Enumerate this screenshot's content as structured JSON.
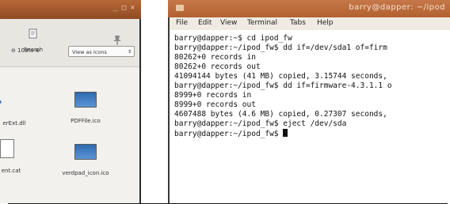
{
  "file_manager": {
    "window_buttons": "_ □ ✕",
    "search_label": "Search",
    "zoom_text": "⊖ 100% ⊕",
    "view_select": "View as Icons",
    "files": [
      {
        "name": "erExt.dll"
      },
      {
        "name": "PDFFile.ico"
      },
      {
        "name": "ent.cat"
      },
      {
        "name": "verdpad_icon.ico"
      }
    ]
  },
  "terminal": {
    "title": "barry@dapper: ~/ipod",
    "menu": [
      "File",
      "Edit",
      "View",
      "Terminal",
      "Tabs",
      "Help"
    ],
    "lines": [
      "barry@dapper:~$ cd ipod_fw",
      "barry@dapper:~/ipod_fw$ dd if=/dev/sda1 of=firm",
      "80262+0 records in",
      "80262+0 records out",
      "41094144 bytes (41 MB) copied, 3.15744 seconds,",
      "barry@dapper:~/ipod_fw$ dd if=firmware-4.3.1.1 o",
      "8999+0 records in",
      "8999+0 records out",
      "4607488 bytes (4.6 MB) copied, 0.27307 seconds,",
      "barry@dapper:~/ipod_fw$ eject /dev/sda",
      "barry@dapper:~/ipod_fw$ "
    ]
  }
}
